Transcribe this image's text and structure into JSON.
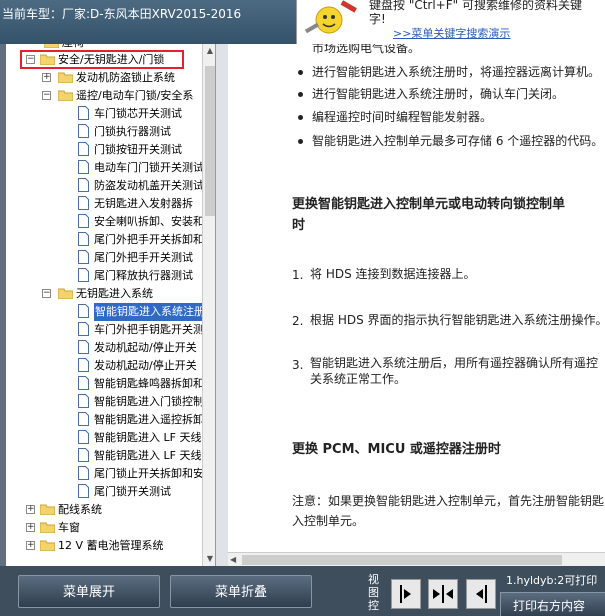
{
  "header": {
    "vehicle_label": "当前车型：厂家:D-东风本田XRV2015-2016"
  },
  "promo": {
    "line1": "键盘按 \"Ctrl+F\" 可搜索维修的资料关键",
    "line2": "字!",
    "link": ">>菜单关键字搜索演示"
  },
  "tree": {
    "top_partial": "座椅",
    "items": [
      {
        "label": "安全/无钥匙进入/门锁"
      },
      {
        "label": "发动机防盗锁止系统"
      },
      {
        "label": "遥控/电动车门锁/安全系"
      },
      {
        "label": "车门锁芯开关测试"
      },
      {
        "label": "门锁执行器测试"
      },
      {
        "label": "门锁按钮开关测试"
      },
      {
        "label": "电动车门门锁开关测试"
      },
      {
        "label": "防盗发动机盖开关测试"
      },
      {
        "label": "无钥匙进入发射器拆"
      },
      {
        "label": "安全喇叭拆卸、安装和"
      },
      {
        "label": "尾门外把手开关拆卸和"
      },
      {
        "label": "尾门外把手开关测试"
      },
      {
        "label": "尾门释放执行器测试"
      },
      {
        "label": "无钥匙进入系统"
      },
      {
        "label": "智能钥匙进入系统注册"
      },
      {
        "label": "车门外把手钥匙开关测"
      },
      {
        "label": "发动机起动/停止开关"
      },
      {
        "label": "发动机起动/停止开关"
      },
      {
        "label": "智能钥匙蜂鸣器拆卸和"
      },
      {
        "label": "智能钥匙进入门锁控制"
      },
      {
        "label": "智能钥匙进入遥控拆卸"
      },
      {
        "label": "智能钥匙进入 LF 天线"
      },
      {
        "label": "智能钥匙进入 LF 天线"
      },
      {
        "label": "尾门锁止开关拆卸和安"
      },
      {
        "label": "尾门锁开关测试"
      },
      {
        "label": "配线系统"
      },
      {
        "label": "车窗"
      },
      {
        "label": "12 V 蓄电池管理系统"
      }
    ]
  },
  "content": {
    "partial_line": "市场选购电气设备。",
    "bullets": [
      "进行智能钥匙进入系统注册时，将遥控器远离计算机。",
      "进行智能钥匙进入系统注册时，确认车门关闭。",
      "编程遥控时间时编程智能发射器。",
      "智能钥匙进入控制单元最多可存储 6 个遥控器的代码。"
    ],
    "heading1_line1": "更换智能钥匙进入控制单元或电动转向锁控制单",
    "heading1_line2": "时",
    "steps": [
      {
        "num": "1.",
        "text": "将 HDS 连接到数据连接器上。"
      },
      {
        "num": "2.",
        "text": "根据 HDS 界面的指示执行智能钥匙进入系统注册操作。"
      },
      {
        "num": "3.",
        "line1": "智能钥匙进入系统注册后，用所有遥控器确认所有遥控",
        "line2": "关系统正常工作。"
      }
    ],
    "heading2": "更换 PCM、MICU 或遥控器注册时",
    "note_line1": "注意：如果更换智能钥匙进入控制单元，首先注册智能钥匙",
    "note_line2": "入控制单元。"
  },
  "bottom": {
    "expand_label": "菜单展开",
    "collapse_label": "菜单折叠",
    "view_label": "视图控",
    "status_text": "1.hyldyb:2可打印",
    "print_label": "打印右方内容"
  },
  "colors": {
    "selection": "#316ac5",
    "highlight_border": "#e8202c",
    "link": "#2c5bbf"
  }
}
